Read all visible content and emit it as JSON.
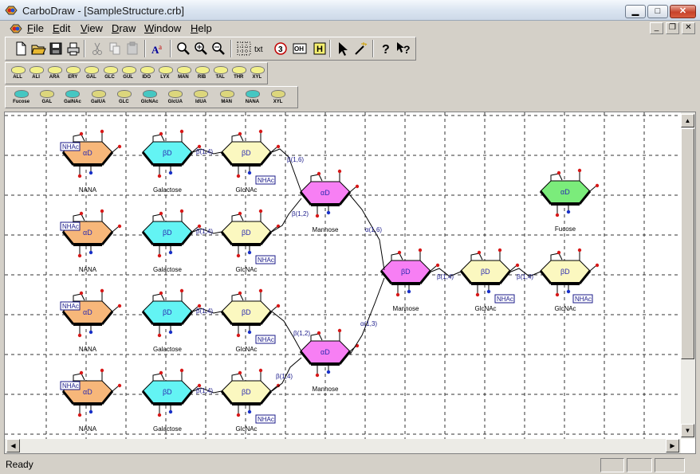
{
  "window": {
    "title": "CarboDraw - [SampleStructure.crb]"
  },
  "menu": [
    "File",
    "Edit",
    "View",
    "Draw",
    "Window",
    "Help"
  ],
  "toolbar_main": [
    "new-file",
    "open-folder",
    "save",
    "print",
    "cut",
    "copy",
    "paste",
    "font",
    "zoom",
    "zoom-in",
    "zoom-out",
    "grid",
    "text",
    "ring-number",
    "oh",
    "h",
    "select-arrow",
    "magic-wand",
    "help",
    "context-help"
  ],
  "toolbar_main_text": {
    "text": "txt",
    "ring_number": "3",
    "oh": "OH",
    "h": "H"
  },
  "toolbar_sugars": [
    "ALL",
    "ALI",
    "ARA",
    "ERY",
    "GAL",
    "GLC",
    "GUL",
    "IDO",
    "LYX",
    "MAN",
    "RIB",
    "TAL",
    "THR",
    "XYL"
  ],
  "toolbar_sugars2": [
    "Fucose",
    "GAL",
    "GalNAc",
    "GalUA",
    "GLC",
    "GlcNAc",
    "GlcUA",
    "IdUA",
    "MAN",
    "NANA",
    "XYL"
  ],
  "status": {
    "text": "Ready"
  },
  "colors": {
    "nana": "#f7b77a",
    "galactose": "#63f4f4",
    "glcnac": "#fbf8c0",
    "mannose": "#f77ff4",
    "fucose": "#7bec7b"
  },
  "diagram": {
    "sugar_labels": {
      "nana": "NANA",
      "galactose": "Galactose",
      "glcnac": "GlcNAc",
      "mannose": "Mannose",
      "fucose": "Fucose"
    },
    "ring_labels": {
      "alpha": "αD",
      "beta": "βD"
    },
    "substituent": "NHAc",
    "links": {
      "b14": "β(1,4)",
      "b12": "β(1,2)",
      "b16": "β(1,6)",
      "a16": "α(1,6)",
      "a13": "α(1,3)"
    }
  }
}
